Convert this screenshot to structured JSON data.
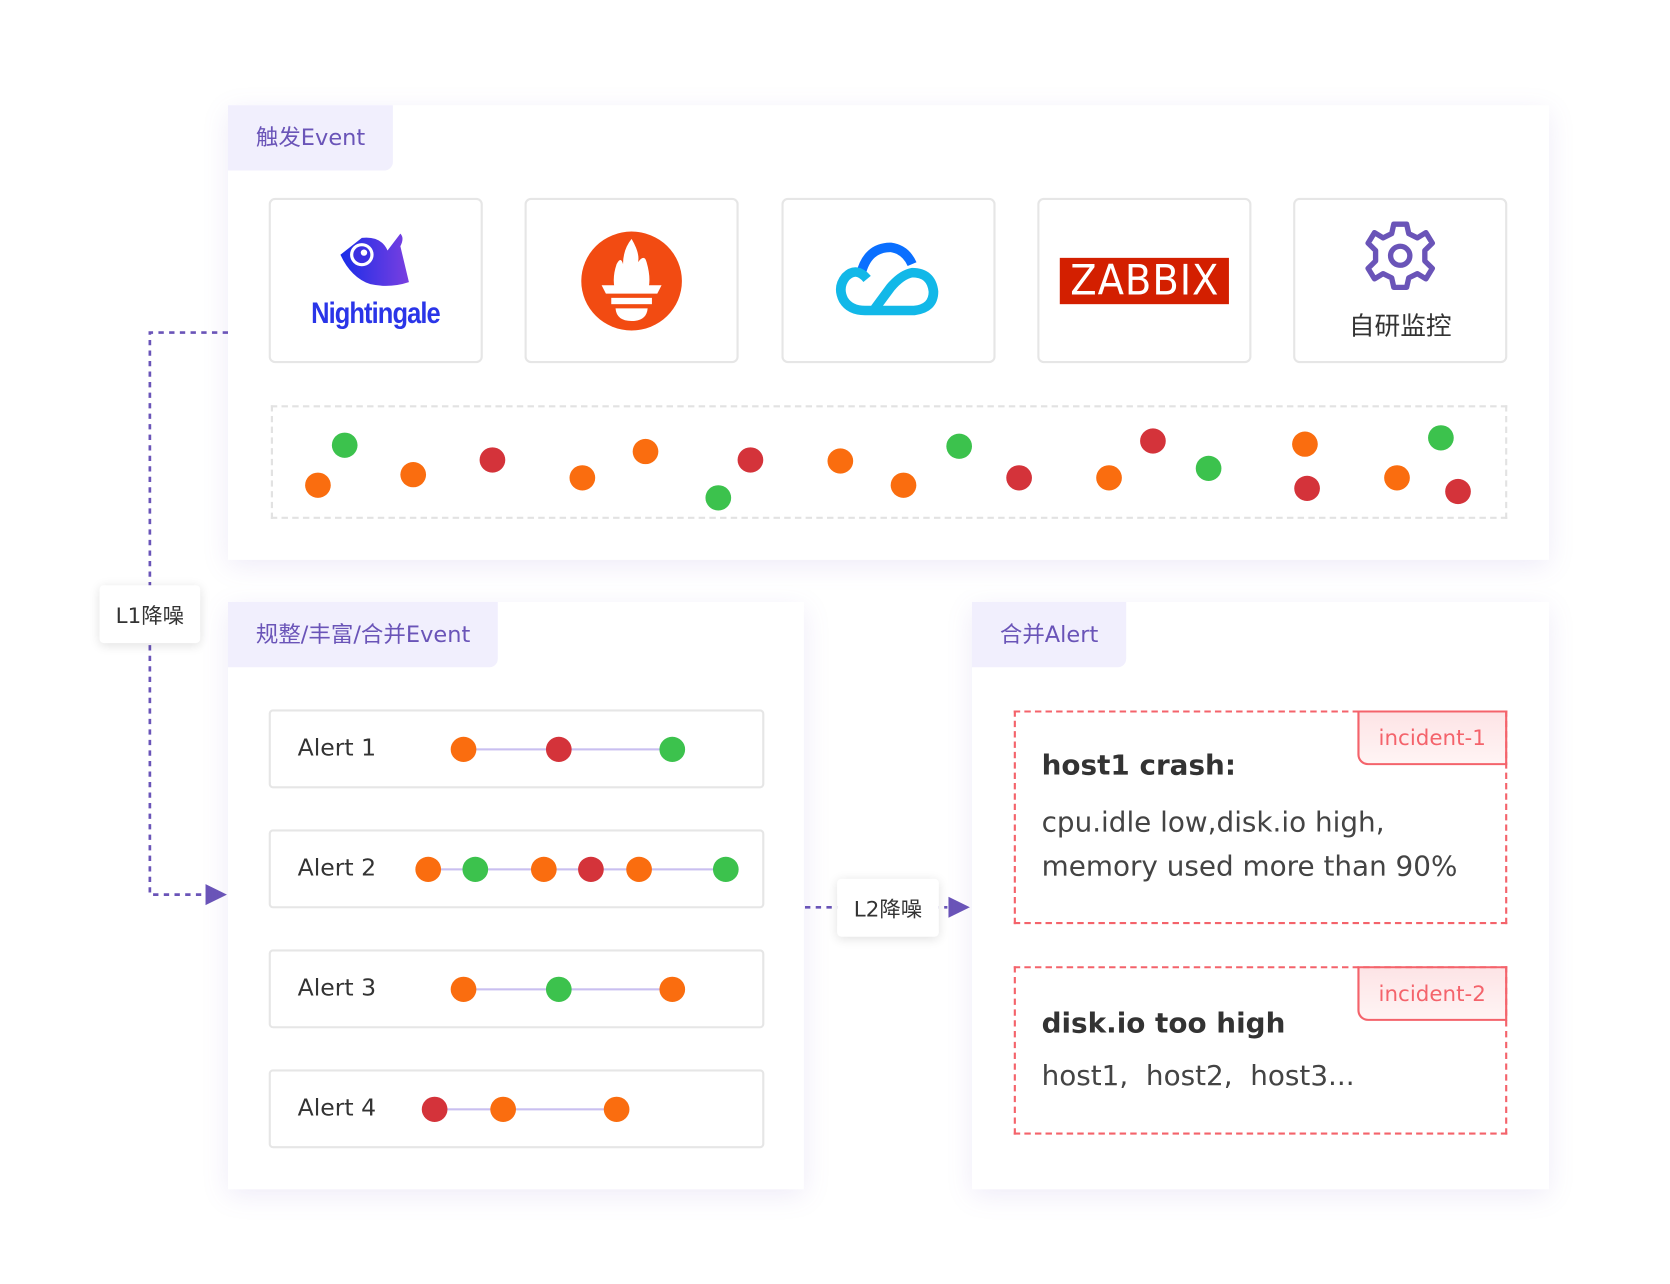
{
  "colors": {
    "orange": "#fa6d0f",
    "green": "#3cc24d",
    "red": "#d4333a",
    "accent": "#6a54b8",
    "incident": "#f4636b"
  },
  "trigger": {
    "title": "触发Event",
    "sources": [
      {
        "name": "Nightingale",
        "icon": "nightingale-bird-logo"
      },
      {
        "name": "Prometheus",
        "icon": "prometheus-torch-logo"
      },
      {
        "name": "Tencent Cloud",
        "icon": "cloud-logo"
      },
      {
        "name": "ZABBIX",
        "icon": "zabbix-logo"
      },
      {
        "name": "自研监控",
        "icon": "gear-icon"
      }
    ],
    "events": [
      "orange",
      "green",
      "orange",
      "red",
      "orange",
      "orange",
      "green",
      "red",
      "orange",
      "orange",
      "green",
      "red",
      "orange",
      "red",
      "green",
      "orange",
      "red",
      "orange",
      "green",
      "red"
    ]
  },
  "l1": {
    "label": "L1降噪"
  },
  "l2": {
    "label": "L2降噪"
  },
  "normalize": {
    "title": "规整/丰富/合并Event",
    "alerts": [
      {
        "label": "Alert 1",
        "events": [
          "orange",
          "red",
          "green"
        ]
      },
      {
        "label": "Alert 2",
        "events": [
          "orange",
          "green",
          "orange",
          "red",
          "orange",
          "green"
        ]
      },
      {
        "label": "Alert 3",
        "events": [
          "orange",
          "green",
          "orange"
        ]
      },
      {
        "label": "Alert 4",
        "events": [
          "red",
          "orange",
          "orange"
        ]
      }
    ]
  },
  "merge": {
    "title": "合并Alert",
    "incidents": [
      {
        "tag": "incident-1",
        "title": "host1 crash:",
        "body": "cpu.idle low,disk.io high,\nmemory used more than 90%"
      },
      {
        "tag": "incident-2",
        "title": "disk.io too high",
        "body": "host1,  host2,  host3..."
      }
    ]
  }
}
